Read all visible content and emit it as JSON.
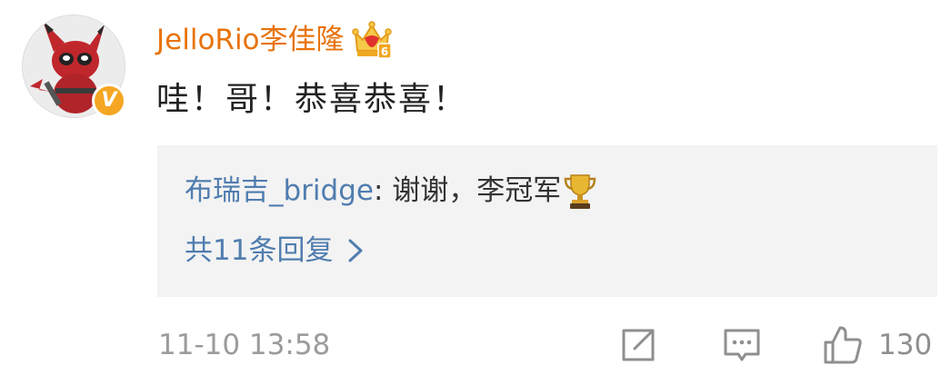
{
  "comment": {
    "username": "JelloRio李佳隆",
    "text": "哇！哥！恭喜恭喜！",
    "vip_badge": "V",
    "level_number": "6",
    "timestamp": "11-10 13:58",
    "like_count": "130"
  },
  "reply": {
    "author": "布瑞吉_bridge",
    "colon": ": ",
    "text": "谢谢，李冠军",
    "more_replies_label": "共11条回复"
  },
  "colors": {
    "username": "#e8730a",
    "link": "#507daf",
    "badge": "#f5a623",
    "reply_bg": "#f3f3f3",
    "meta": "#9b9b9b"
  },
  "icons": {
    "avatar": "deadpool-pikachu-avatar",
    "vip": "verified-v-icon",
    "crown": "crown-level-icon",
    "trophy": "trophy-icon",
    "chevron": "chevron-right-icon",
    "share": "share-icon",
    "reply": "comment-icon",
    "like": "thumbs-up-icon"
  }
}
